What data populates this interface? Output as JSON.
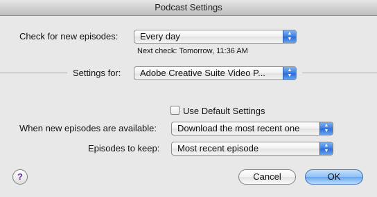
{
  "window": {
    "title": "Podcast Settings"
  },
  "check": {
    "label": "Check for new episodes:",
    "value": "Every day",
    "next_check": "Next check: Tomorrow, 11:36 AM"
  },
  "settings_for": {
    "label": "Settings for:",
    "value": "Adobe Creative Suite Video P..."
  },
  "use_default": {
    "label": "Use Default Settings",
    "checked": false
  },
  "new_episodes": {
    "label": "When new episodes are available:",
    "value": "Download the most recent one"
  },
  "keep": {
    "label": "Episodes to keep:",
    "value": "Most recent episode"
  },
  "buttons": {
    "help": "?",
    "cancel": "Cancel",
    "ok": "OK"
  },
  "colors": {
    "accent": "#3b7ce0",
    "default_button": "#8fc0f2",
    "help_glyph": "#6a2fa8"
  },
  "icons": {
    "popup_arrows": "up-down-chevron-icon",
    "help": "help-icon"
  }
}
